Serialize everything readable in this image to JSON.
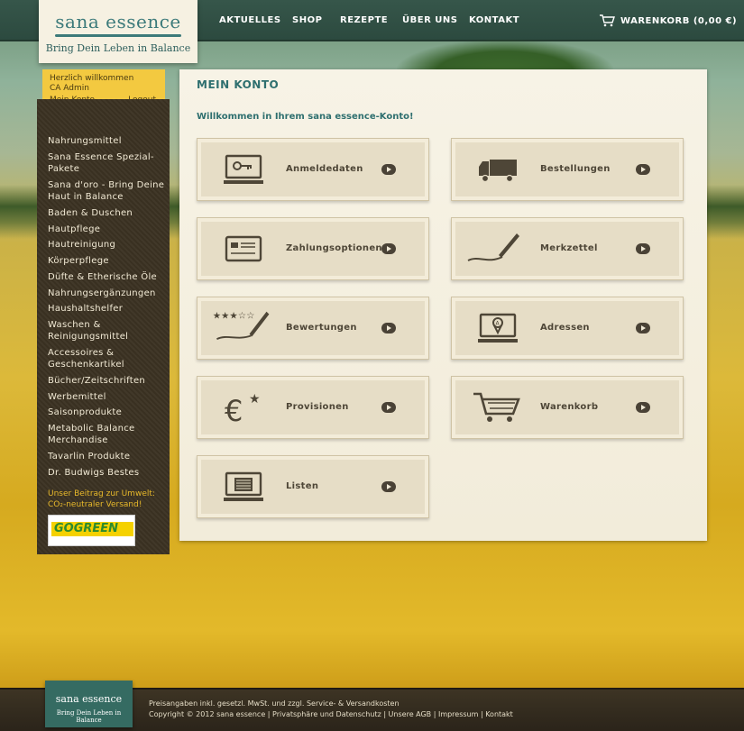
{
  "header": {
    "logo_brand": "sana essence",
    "logo_slogan": "Bring Dein Leben in Balance",
    "nav": [
      "AKTUELLES",
      "SHOP",
      "REZEPTE",
      "ÜBER UNS",
      "KONTAKT"
    ],
    "cart_label": "WARENKORB (0,00 €)"
  },
  "welcome": {
    "greeting": "Herzlich willkommen",
    "user": "CA Admin",
    "my_account": "Mein Konto",
    "logout": "Logout"
  },
  "sidebar": {
    "items": [
      "Nahrungsmittel",
      "Sana Essence Spezial-Pakete",
      "Sana d'oro - Bring Deine Haut in Balance",
      "Baden & Duschen",
      "Hautpflege",
      "Hautreinigung",
      "Körperpflege",
      "Düfte & Etherische Öle",
      "Nahrungsergänzungen",
      "Haushaltshelfer",
      "Waschen & Reinigungsmittel",
      "Accessoires & Geschenkartikel",
      "Bücher/Zeitschriften",
      "Werbemittel",
      "Saisonprodukte",
      "Metabolic Balance Merchandise",
      "Tavarlin Produkte",
      "Dr. Budwigs Bestes"
    ],
    "eco_text_line1": "Unser Beitrag zur Umwelt:",
    "eco_text_line2": "CO₂-neutraler Versand!",
    "gogreen": "GOGREEN"
  },
  "main": {
    "title": "MEIN KONTO",
    "intro": "Willkommen in Ihrem sana essence-Konto!",
    "tiles": [
      {
        "label": "Anmeldedaten",
        "icon": "key-laptop-icon"
      },
      {
        "label": "Bestellungen",
        "icon": "truck-icon"
      },
      {
        "label": "Zahlungsoptionen",
        "icon": "credit-card-icon"
      },
      {
        "label": "Merkzettel",
        "icon": "pen-icon"
      },
      {
        "label": "Bewertungen",
        "icon": "stars-pen-icon"
      },
      {
        "label": "Adressen",
        "icon": "map-pin-laptop-icon"
      },
      {
        "label": "Provisionen",
        "icon": "euro-star-icon"
      },
      {
        "label": "Warenkorb",
        "icon": "shopping-cart-icon"
      },
      {
        "label": "Listen",
        "icon": "list-laptop-icon"
      }
    ]
  },
  "footer": {
    "logo_brand": "sana essence",
    "logo_slogan": "Bring Dein Leben in Balance",
    "line1": "Preisangaben inkl. gesetzl. MwSt. und zzgl. Service- & Versandkosten",
    "line2": "Copyright © 2012 sana essence  |  Privatsphäre und Datenschutz  |  Unsere AGB  |  Impressum  |  Kontakt"
  }
}
